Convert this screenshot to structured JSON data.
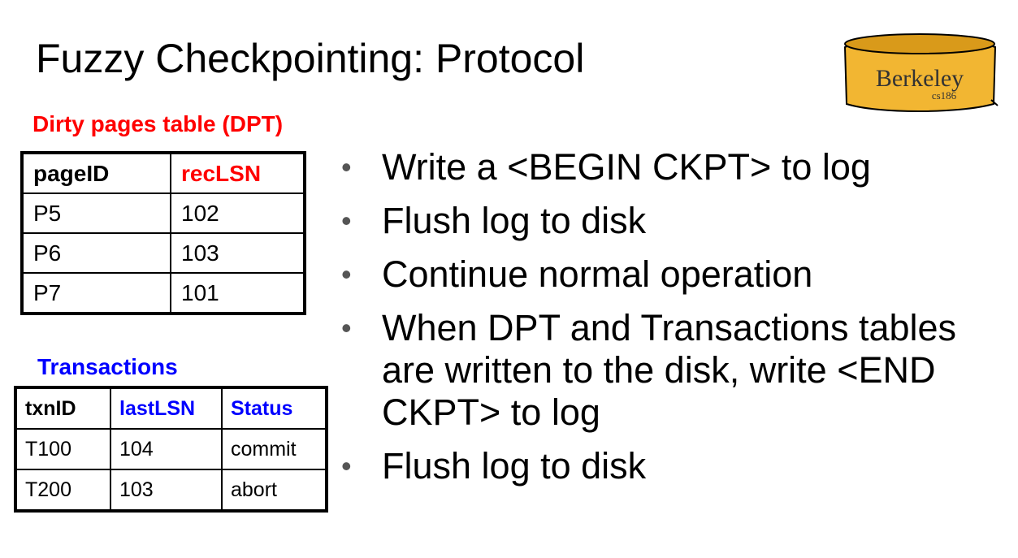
{
  "title": "Fuzzy Checkpointing: Protocol",
  "logo": {
    "main": "Berkeley",
    "sub": "cs186"
  },
  "dpt": {
    "label": "Dirty pages table (DPT)",
    "label_color": "#ff0000",
    "headers": [
      "pageID",
      "recLSN"
    ],
    "header_colors": [
      "#000000",
      "#ff0000"
    ],
    "rows": [
      [
        "P5",
        "102"
      ],
      [
        "P6",
        "103"
      ],
      [
        "P7",
        "101"
      ]
    ]
  },
  "transactions": {
    "label": "Transactions",
    "label_color": "#0000ff",
    "headers": [
      "txnID",
      "lastLSN",
      "Status"
    ],
    "header_colors": [
      "#000000",
      "#0000ff",
      "#0000ff"
    ],
    "rows": [
      [
        "T100",
        "104",
        "commit"
      ],
      [
        "T200",
        "103",
        "abort"
      ]
    ]
  },
  "bullets": [
    "Write a <BEGIN CKPT> to log",
    "Flush log to disk",
    "Continue normal operation",
    "When DPT and Transactions tables are written to the disk, write <END CKPT> to log",
    "Flush log to disk"
  ],
  "bullet_glyph": "•"
}
